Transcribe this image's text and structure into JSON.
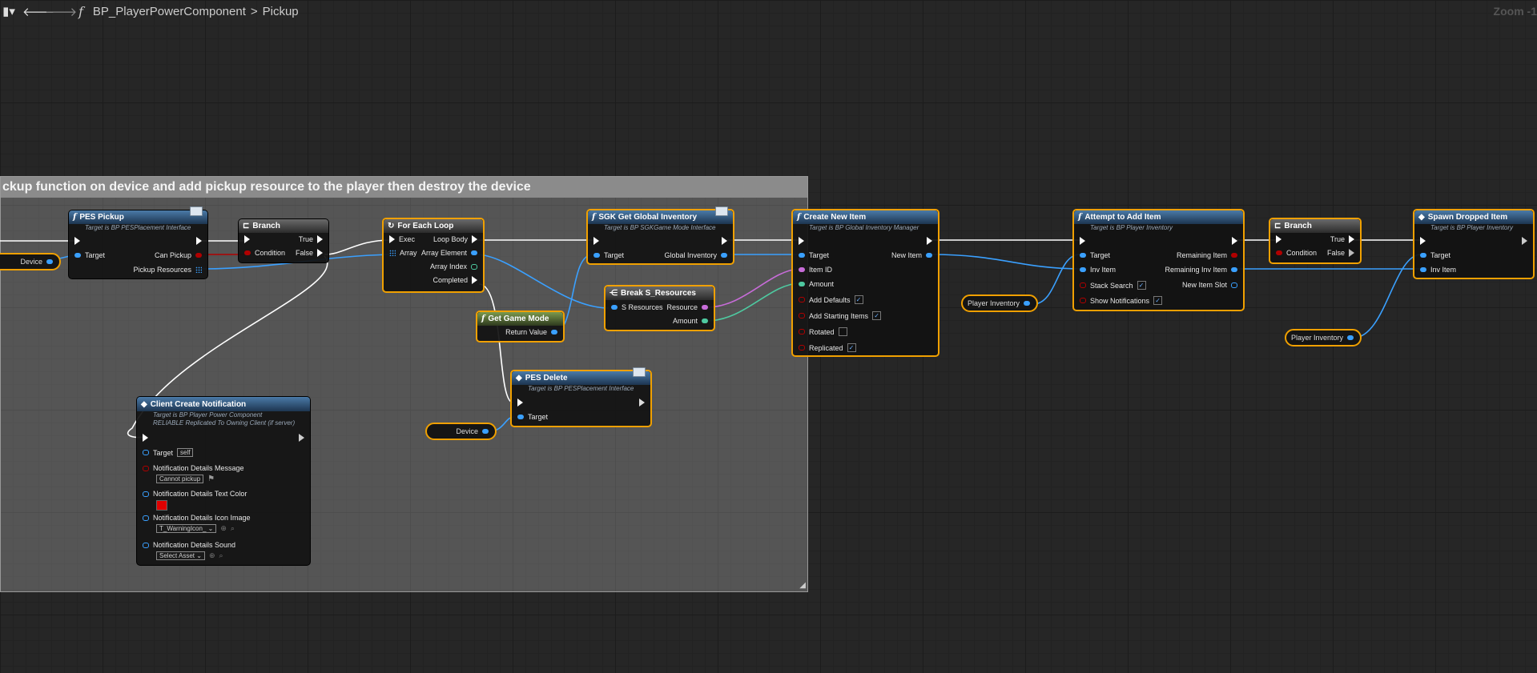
{
  "toolbar": {
    "function_icon": "f",
    "breadcrumb_blueprint": "BP_PlayerPowerComponent",
    "breadcrumb_separator": ">",
    "breadcrumb_function": "Pickup",
    "zoom_label": "Zoom -1"
  },
  "comment": {
    "text": "ckup function on device and add pickup resource to the player then destroy the device"
  },
  "variables": {
    "device_1": "Device",
    "device_2": "Device",
    "player_inventory_1": "Player Inventory",
    "player_inventory_2": "Player Inventory"
  },
  "nodes": {
    "pes_pickup": {
      "title": "PES Pickup",
      "subtitle": "Target is BP PESPlacement Interface",
      "target": "Target",
      "can_pickup": "Can Pickup",
      "pickup_resources": "Pickup Resources"
    },
    "branch1": {
      "title": "Branch",
      "condition": "Condition",
      "true": "True",
      "false": "False"
    },
    "for_each": {
      "title": "For Each Loop",
      "exec": "Exec",
      "array": "Array",
      "loop_body": "Loop Body",
      "array_element": "Array Element",
      "array_index": "Array Index",
      "completed": "Completed"
    },
    "get_game_mode": {
      "title": "Get Game Mode",
      "return_value": "Return Value"
    },
    "sgk_global": {
      "title": "SGK Get Global Inventory",
      "subtitle": "Target is BP SGKGame Mode Interface",
      "target": "Target",
      "global_inventory": "Global Inventory"
    },
    "break_res": {
      "title": "Break S_Resources",
      "s_resources": "S Resources",
      "resource": "Resource",
      "amount": "Amount"
    },
    "pes_delete": {
      "title": "PES Delete",
      "subtitle": "Target is BP PESPlacement Interface",
      "target": "Target"
    },
    "client_notify": {
      "title": "Client Create Notification",
      "subtitle1": "Target is BP Player Power Component",
      "subtitle2": "RELIABLE Replicated To Owning Client (if server)",
      "target": "Target",
      "target_value": "self",
      "msg_label": "Notification Details Message",
      "msg_value": "Cannot pickup",
      "color_label": "Notification Details Text Color",
      "icon_label": "Notification Details Icon Image",
      "icon_value": "T_WarningIcon_",
      "sound_label": "Notification Details Sound",
      "sound_value": "Select Asset"
    },
    "create_item": {
      "title": "Create New Item",
      "subtitle": "Target is BP Global Inventory Manager",
      "target": "Target",
      "item_id": "Item ID",
      "amount": "Amount",
      "add_defaults": "Add Defaults",
      "add_starting": "Add Starting Items",
      "rotated": "Rotated",
      "replicated": "Replicated",
      "new_item": "New Item"
    },
    "attempt_add": {
      "title": "Attempt to Add Item",
      "subtitle": "Target is BP Player Inventory",
      "target": "Target",
      "inv_item": "Inv Item",
      "stack_search": "Stack Search",
      "show_notifications": "Show Notifications",
      "remaining_item": "Remaining Item",
      "remaining_inv_item": "Remaining Inv Item",
      "new_item_slot": "New Item Slot"
    },
    "branch2": {
      "title": "Branch",
      "condition": "Condition",
      "true": "True",
      "false": "False"
    },
    "spawn_dropped": {
      "title": "Spawn Dropped Item",
      "subtitle": "Target is BP Player Inventory",
      "target": "Target",
      "inv_item": "Inv Item"
    }
  },
  "colors": {
    "exec_wire": "#ffffff",
    "object_wire": "#3aa0ff",
    "bool_wire": "#b00000",
    "selection": "#f0a000",
    "text_color_swatch": "#e00000"
  }
}
